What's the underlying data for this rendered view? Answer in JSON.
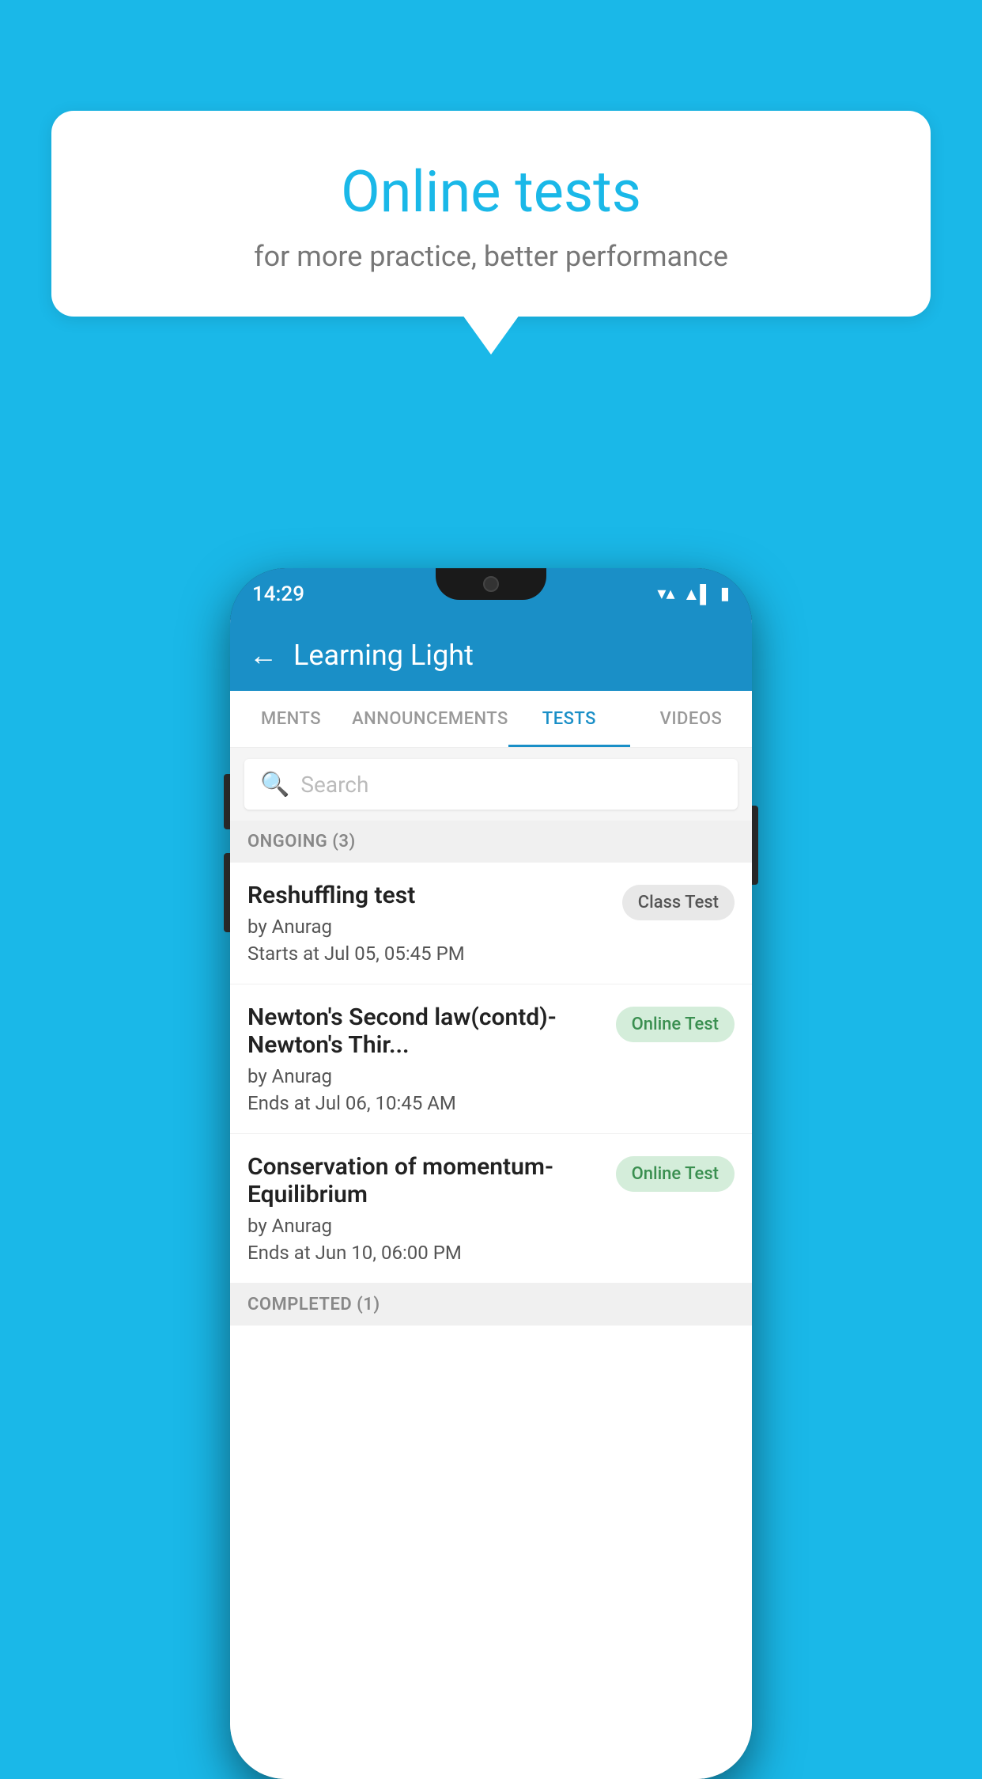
{
  "background_color": "#1ab8e8",
  "speech_bubble": {
    "title": "Online tests",
    "subtitle": "for more practice, better performance"
  },
  "phone": {
    "status_bar": {
      "time": "14:29",
      "wifi_icon": "▼",
      "signal_icon": "▲",
      "battery_icon": "▌"
    },
    "app_bar": {
      "back_label": "←",
      "title": "Learning Light"
    },
    "tabs": [
      {
        "label": "MENTS",
        "active": false
      },
      {
        "label": "ANNOUNCEMENTS",
        "active": false
      },
      {
        "label": "TESTS",
        "active": true
      },
      {
        "label": "VIDEOS",
        "active": false
      }
    ],
    "search": {
      "placeholder": "Search"
    },
    "ongoing_section": {
      "label": "ONGOING (3)"
    },
    "tests": [
      {
        "name": "Reshuffling test",
        "by": "by Anurag",
        "time_label": "Starts at",
        "time": "Jul 05, 05:45 PM",
        "badge": "Class Test",
        "badge_type": "class"
      },
      {
        "name": "Newton's Second law(contd)-Newton's Thir...",
        "by": "by Anurag",
        "time_label": "Ends at",
        "time": "Jul 06, 10:45 AM",
        "badge": "Online Test",
        "badge_type": "online"
      },
      {
        "name": "Conservation of momentum-Equilibrium",
        "by": "by Anurag",
        "time_label": "Ends at",
        "time": "Jun 10, 06:00 PM",
        "badge": "Online Test",
        "badge_type": "online"
      }
    ],
    "completed_section": {
      "label": "COMPLETED (1)"
    }
  }
}
